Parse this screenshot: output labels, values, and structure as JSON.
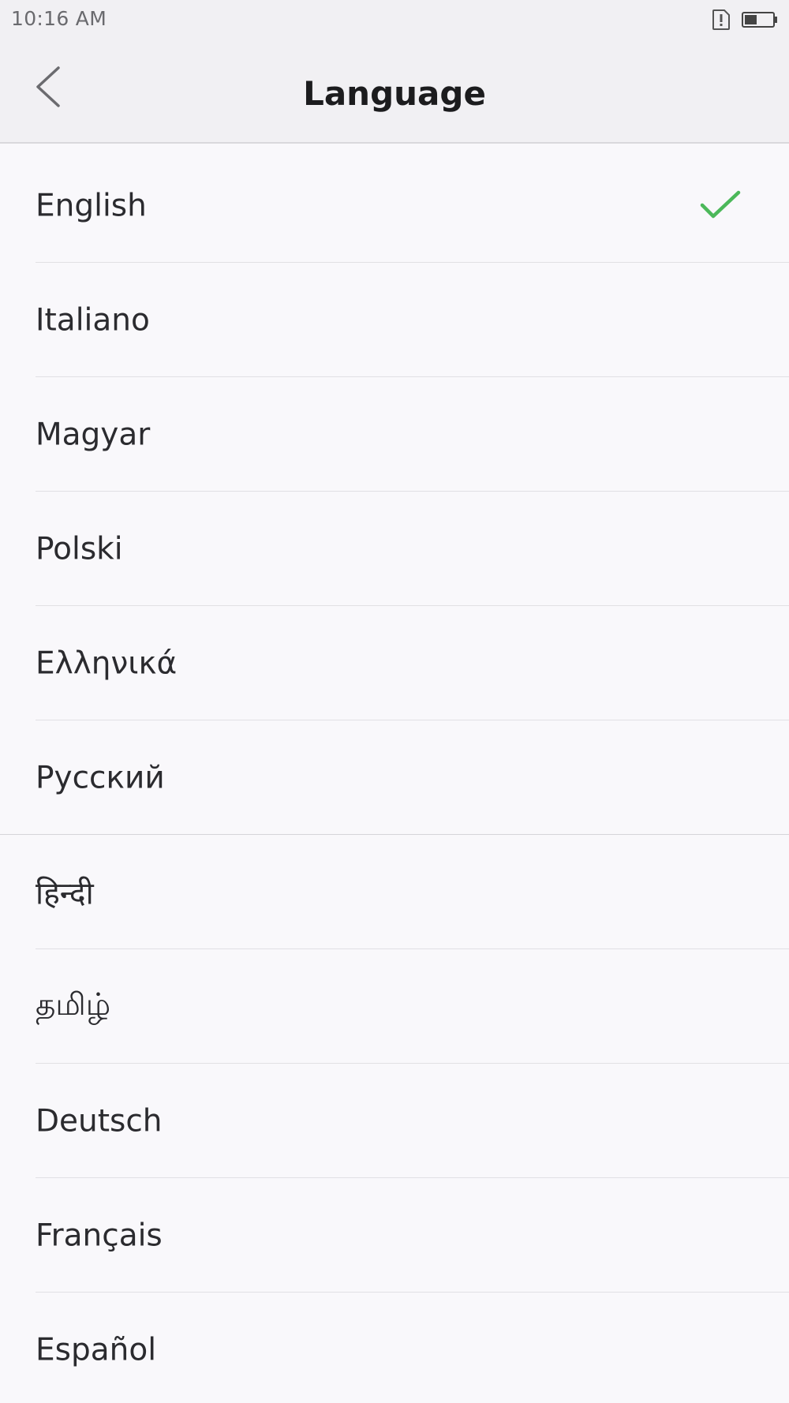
{
  "status_bar": {
    "time": "10:16 AM",
    "icons": [
      "sim-alert-icon",
      "battery-icon"
    ]
  },
  "header": {
    "title": "Language",
    "back_icon": "chevron-left-icon"
  },
  "languages": [
    {
      "label": "English",
      "selected": true
    },
    {
      "label": "Italiano",
      "selected": false
    },
    {
      "label": "Magyar",
      "selected": false
    },
    {
      "label": "Polski",
      "selected": false
    },
    {
      "label": "Ελληνικά",
      "selected": false
    },
    {
      "label": "Русский",
      "selected": false
    },
    {
      "label": "हिन्दी",
      "selected": false
    },
    {
      "label": "தமிழ்",
      "selected": false
    },
    {
      "label": "Deutsch",
      "selected": false
    },
    {
      "label": "Français",
      "selected": false
    },
    {
      "label": "Español",
      "selected": false
    }
  ],
  "colors": {
    "check": "#4cb85a",
    "background": "#f9f8fb",
    "header_bg": "#f1f0f3",
    "divider": "#e1e0e4"
  }
}
